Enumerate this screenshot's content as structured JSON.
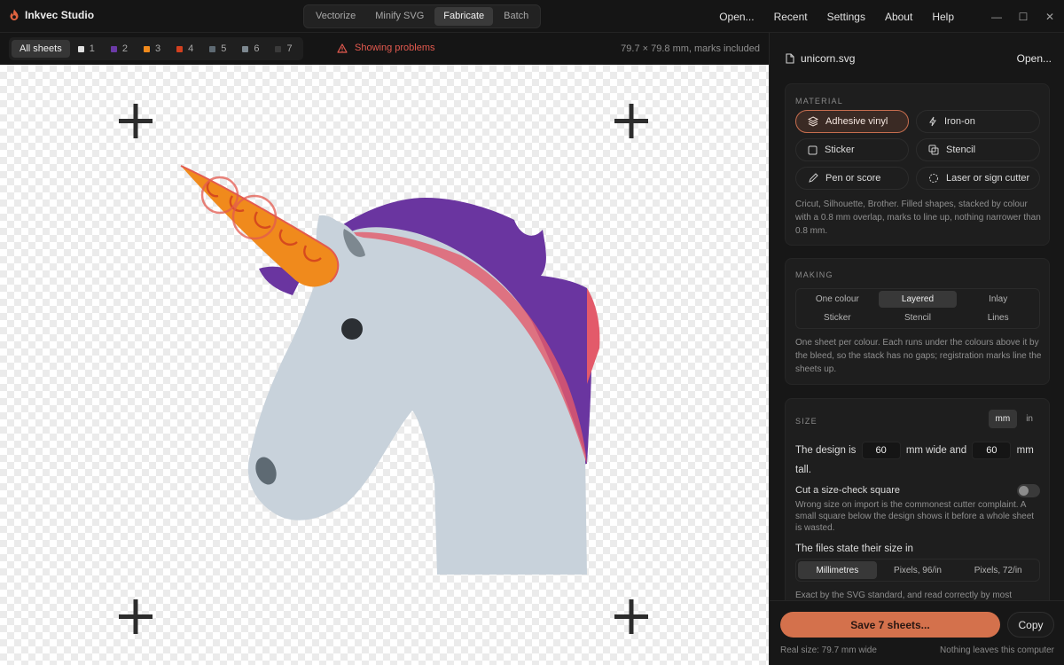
{
  "app": {
    "title": "Inkvec Studio",
    "logo_icon": "flame-icon"
  },
  "modes": [
    {
      "label": "Vectorize",
      "active": false
    },
    {
      "label": "Minify SVG",
      "active": false
    },
    {
      "label": "Fabricate",
      "active": true
    },
    {
      "label": "Batch",
      "active": false
    }
  ],
  "menu": {
    "open": "Open...",
    "recent": "Recent",
    "settings": "Settings",
    "about": "About",
    "help": "Help"
  },
  "window_controls": {
    "minimize": "—",
    "maximize": "☐",
    "close": "✕"
  },
  "sheetbar": {
    "all": "All sheets",
    "sheets": [
      {
        "label": "1",
        "color": "#e0e0e0"
      },
      {
        "label": "2",
        "color": "#6b3aa6"
      },
      {
        "label": "3",
        "color": "#f08a1c"
      },
      {
        "label": "4",
        "color": "#d2401f"
      },
      {
        "label": "5",
        "color": "#5e6a73"
      },
      {
        "label": "6",
        "color": "#7d8890"
      },
      {
        "label": "7",
        "color": "#3a3a3a"
      }
    ],
    "problems": "Showing problems",
    "dimensions": "79.7 × 79.8 mm, marks included"
  },
  "panel": {
    "file_name": "unicorn.svg",
    "open_label": "Open...",
    "material": {
      "title": "MATERIAL",
      "options": [
        {
          "label": "Adhesive vinyl",
          "icon": "layers-icon",
          "active": true
        },
        {
          "label": "Iron-on",
          "icon": "bolt-icon",
          "active": false
        },
        {
          "label": "Sticker",
          "icon": "square-icon",
          "active": false
        },
        {
          "label": "Stencil",
          "icon": "copy-icon",
          "active": false
        },
        {
          "label": "Pen or score",
          "icon": "pen-icon",
          "active": false
        },
        {
          "label": "Laser or sign cutter",
          "icon": "laser-icon",
          "active": false
        }
      ],
      "description": "Cricut, Silhouette, Brother. Filled shapes, stacked by colour with a 0.8 mm overlap, marks to line up, nothing narrower than 0.8 mm."
    },
    "making": {
      "title": "MAKING",
      "options": [
        {
          "label": "One colour",
          "active": false
        },
        {
          "label": "Layered",
          "active": true
        },
        {
          "label": "Inlay",
          "active": false
        },
        {
          "label": "Sticker",
          "active": false
        },
        {
          "label": "Stencil",
          "active": false
        },
        {
          "label": "Lines",
          "active": false
        }
      ],
      "description": "One sheet per colour. Each runs under the colours above it by the bleed, so the stack has no gaps; registration marks line the sheets up."
    },
    "size": {
      "title": "SIZE",
      "units": [
        {
          "label": "mm",
          "active": true
        },
        {
          "label": "in",
          "active": false
        }
      ],
      "design_is": "The design is",
      "width": "60",
      "mm_wide_and": "mm wide and",
      "height": "60",
      "mm_tall": "mm tall.",
      "size_check_label": "Cut a size-check square",
      "size_check_on": false,
      "size_check_desc": "Wrong size on import is the commonest cutter complaint. A small square below the design shows it before a whole sheet is wasted.",
      "files_state": "The files state their size in",
      "file_units": [
        {
          "label": "Millimetres",
          "active": true
        },
        {
          "label": "Pixels, 96/in",
          "active": false
        },
        {
          "label": "Pixels, 72/in",
          "active": false
        }
      ],
      "file_units_desc": "Exact by the SVG standard, and read correctly by most"
    },
    "footer": {
      "save": "Save 7 sheets...",
      "copy": "Copy",
      "real_size": "Real size: 79.7 mm wide",
      "privacy": "Nothing leaves this computer"
    }
  }
}
